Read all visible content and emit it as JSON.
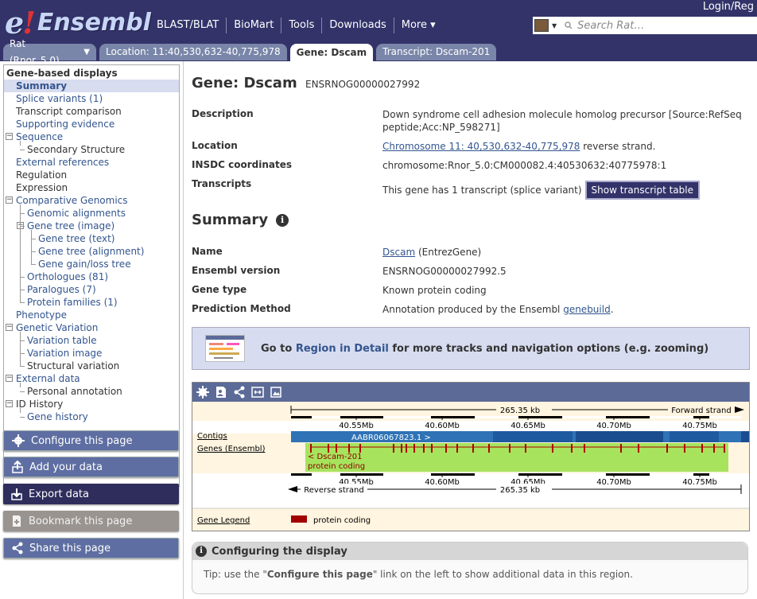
{
  "masthead": {
    "logo_e": "e",
    "logo_bang": "!",
    "logo_text": "Ensembl",
    "nav": [
      "BLAST/BLAT",
      "BioMart",
      "Tools",
      "Downloads",
      "More ▾"
    ],
    "login": "Login/Reg",
    "search_placeholder": "Search Rat…"
  },
  "tabs": {
    "species": "Rat (Rnor_5.0)",
    "location": "Location: 11:40,530,632-40,775,978",
    "gene": "Gene: Dscam",
    "transcript": "Transcript: Dscam-201"
  },
  "sidebar": {
    "title": "Gene-based displays",
    "items": [
      {
        "label": "Summary"
      },
      {
        "label": "Splice variants (1)"
      },
      {
        "label": "Transcript comparison"
      },
      {
        "label": "Supporting evidence"
      },
      {
        "label": "Sequence"
      },
      {
        "label": "Secondary Structure"
      },
      {
        "label": "External references"
      },
      {
        "label": "Regulation"
      },
      {
        "label": "Expression"
      },
      {
        "label": "Comparative Genomics"
      },
      {
        "label": "Genomic alignments"
      },
      {
        "label": "Gene tree (image)"
      },
      {
        "label": "Gene tree (text)"
      },
      {
        "label": "Gene tree (alignment)"
      },
      {
        "label": "Gene gain/loss tree"
      },
      {
        "label": "Orthologues (81)"
      },
      {
        "label": "Paralogues (7)"
      },
      {
        "label": "Protein families (1)"
      },
      {
        "label": "Phenotype"
      },
      {
        "label": "Genetic Variation"
      },
      {
        "label": "Variation table"
      },
      {
        "label": "Variation image"
      },
      {
        "label": "Structural variation"
      },
      {
        "label": "External data"
      },
      {
        "label": "Personal annotation"
      },
      {
        "label": "ID History"
      },
      {
        "label": "Gene history"
      }
    ],
    "buttons": [
      "Configure this page",
      "Add your data",
      "Export data",
      "Bookmark this page",
      "Share this page"
    ]
  },
  "gene": {
    "heading": "Gene: Dscam",
    "stable_id": "ENSRNOG00000027992",
    "description_label": "Description",
    "description": "Down syndrome cell adhesion molecule homolog precursor [Source:RefSeq peptide;Acc:NP_598271]",
    "location_label": "Location",
    "location_link": "Chromosome 11: 40,530,632-40,775,978",
    "location_suffix": " reverse strand.",
    "insdc_label": "INSDC coordinates",
    "insdc": "chromosome:Rnor_5.0:CM000082.4:40530632:40775978:1",
    "transcripts_label": "Transcripts",
    "transcripts_text": "This gene has 1 transcript (splice variant)",
    "transcripts_button": "Show transcript table"
  },
  "summary": {
    "heading": "Summary",
    "name_label": "Name",
    "name_link": "Dscam",
    "name_suffix": " (EntrezGene)",
    "version_label": "Ensembl version",
    "version": "ENSRNOG00000027992.5",
    "type_label": "Gene type",
    "type": "Known protein coding",
    "method_label": "Prediction Method",
    "method_prefix": "Annotation produced by the Ensembl ",
    "method_link": "genebuild",
    "method_suffix": "."
  },
  "region_box": {
    "prefix": "Go to ",
    "link": "Region in Detail",
    "suffix": " for more tracks and navigation options (e.g. zooming)"
  },
  "image": {
    "scale_label": "265.35 kb",
    "forward_strand": "Forward strand",
    "reverse_strand": "Reverse strand",
    "ticks": [
      "40.55Mb",
      "40.60Mb",
      "40.65Mb",
      "40.70Mb",
      "40.75Mb"
    ],
    "contigs_label": "Contigs",
    "contig_name": "AABR06067823.1 >",
    "genes_label": "Genes (Ensembl)",
    "gene_name": "< Dscam-201",
    "gene_biotype": "protein coding",
    "legend_label": "Gene Legend",
    "legend_entry": "protein coding",
    "colors": {
      "contig": "#2f73b6",
      "gene_bg": "#a7e35d",
      "exon": "#b00000",
      "legend": "#a00000"
    }
  },
  "configuring": {
    "heading": "Configuring the display",
    "tip_prefix": "Tip: use the \"",
    "tip_bold": "Configure this page",
    "tip_suffix": "\" link on the left to show additional data in this region."
  }
}
